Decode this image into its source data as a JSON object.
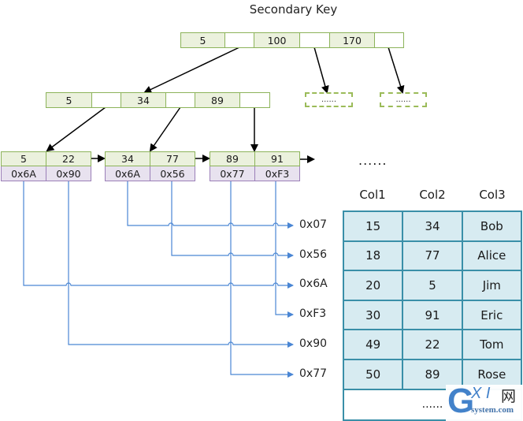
{
  "title": "Secondary Key",
  "root_node": {
    "keys": [
      "5",
      "100",
      "170"
    ]
  },
  "internal_node": {
    "keys": [
      "5",
      "34",
      "89"
    ]
  },
  "placeholder_nodes": [
    "......",
    "......"
  ],
  "leaf_nodes": [
    {
      "keys": [
        "5",
        "22"
      ],
      "addresses": [
        "0x6A",
        "0x90"
      ]
    },
    {
      "keys": [
        "34",
        "77"
      ],
      "addresses": [
        "0x6A",
        "0x56"
      ]
    },
    {
      "keys": [
        "89",
        "91"
      ],
      "addresses": [
        "0x77",
        "0xF3"
      ]
    }
  ],
  "leaf_continuation": "......",
  "row_addresses": [
    "0x07",
    "0x56",
    "0x6A",
    "0xF3",
    "0x90",
    "0x77"
  ],
  "table": {
    "columns": [
      "Col1",
      "Col2",
      "Col3"
    ],
    "rows": [
      [
        "15",
        "34",
        "Bob"
      ],
      [
        "18",
        "77",
        "Alice"
      ],
      [
        "20",
        "5",
        "Jim"
      ],
      [
        "30",
        "91",
        "Eric"
      ],
      [
        "49",
        "22",
        "Tom"
      ],
      [
        "50",
        "89",
        "Rose"
      ]
    ],
    "continuation": "......"
  },
  "watermark": {
    "letter": "G",
    "text": "X I",
    "cn": "网",
    "domain": "system.com"
  },
  "colors": {
    "key_border": "#8cb35a",
    "key_fill": "#ebf1dd",
    "addr_border": "#9b7fb8",
    "addr_fill": "#e8e2ef",
    "table_border": "#3a8fa8",
    "table_fill": "#d7ebf1",
    "pointer_line": "#4a86d4",
    "tree_arrow": "#000000"
  }
}
